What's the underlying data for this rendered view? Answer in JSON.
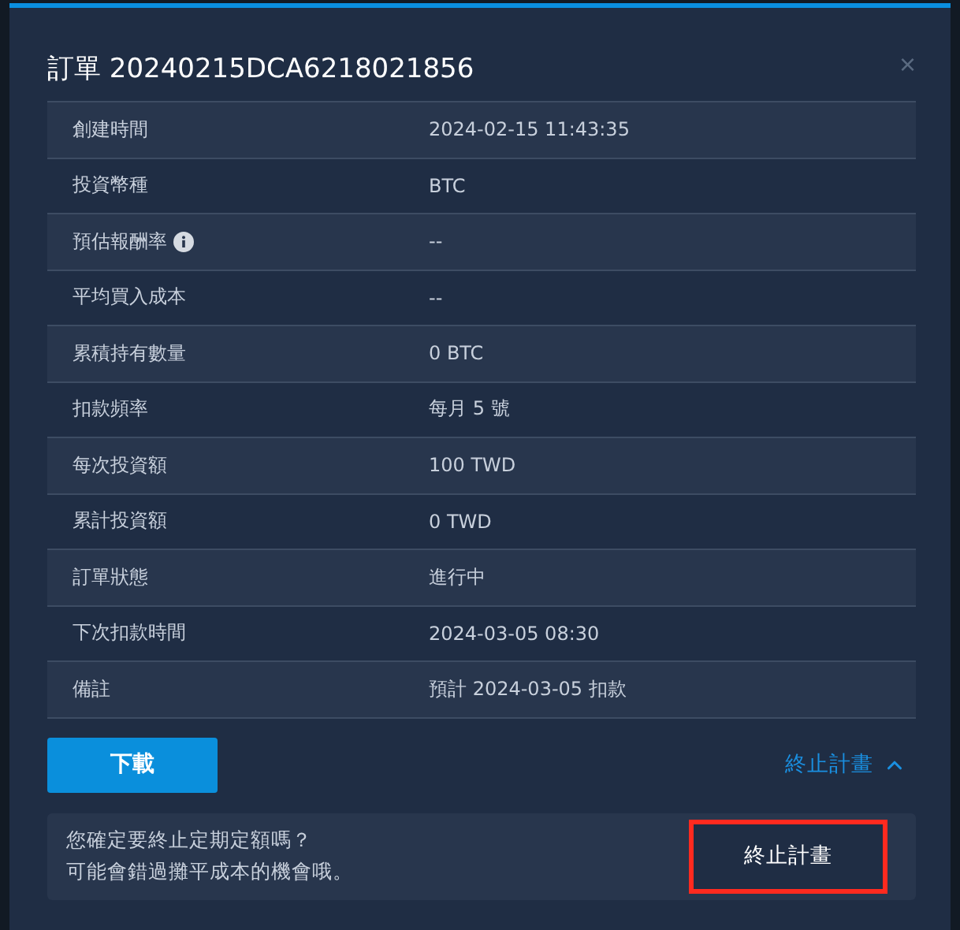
{
  "dialog": {
    "title": "訂單 20240215DCA6218021856",
    "close": "×"
  },
  "details": [
    {
      "label": "創建時間",
      "value": "2024-02-15 11:43:35",
      "info": false
    },
    {
      "label": "投資幣種",
      "value": "BTC",
      "info": false
    },
    {
      "label": "預估報酬率",
      "value": "--",
      "info": true
    },
    {
      "label": "平均買入成本",
      "value": "--",
      "info": false
    },
    {
      "label": "累積持有數量",
      "value": "0 BTC",
      "info": false
    },
    {
      "label": "扣款頻率",
      "value": "每月 5 號",
      "info": false
    },
    {
      "label": "每次投資額",
      "value": "100 TWD",
      "info": false
    },
    {
      "label": "累計投資額",
      "value": "0 TWD",
      "info": false
    },
    {
      "label": "訂單狀態",
      "value": "進行中",
      "info": false
    },
    {
      "label": "下次扣款時間",
      "value": "2024-03-05 08:30",
      "info": false
    },
    {
      "label": "備註",
      "value": "預計 2024-03-05 扣款",
      "info": false
    }
  ],
  "download_button": "下載",
  "stop_toggle": {
    "label": "終止計畫",
    "expanded": true
  },
  "confirm": {
    "lines": [
      "您確定要終止定期定額嗎？",
      "可能會錯過攤平成本的機會哦。"
    ],
    "button": "終止計畫"
  }
}
